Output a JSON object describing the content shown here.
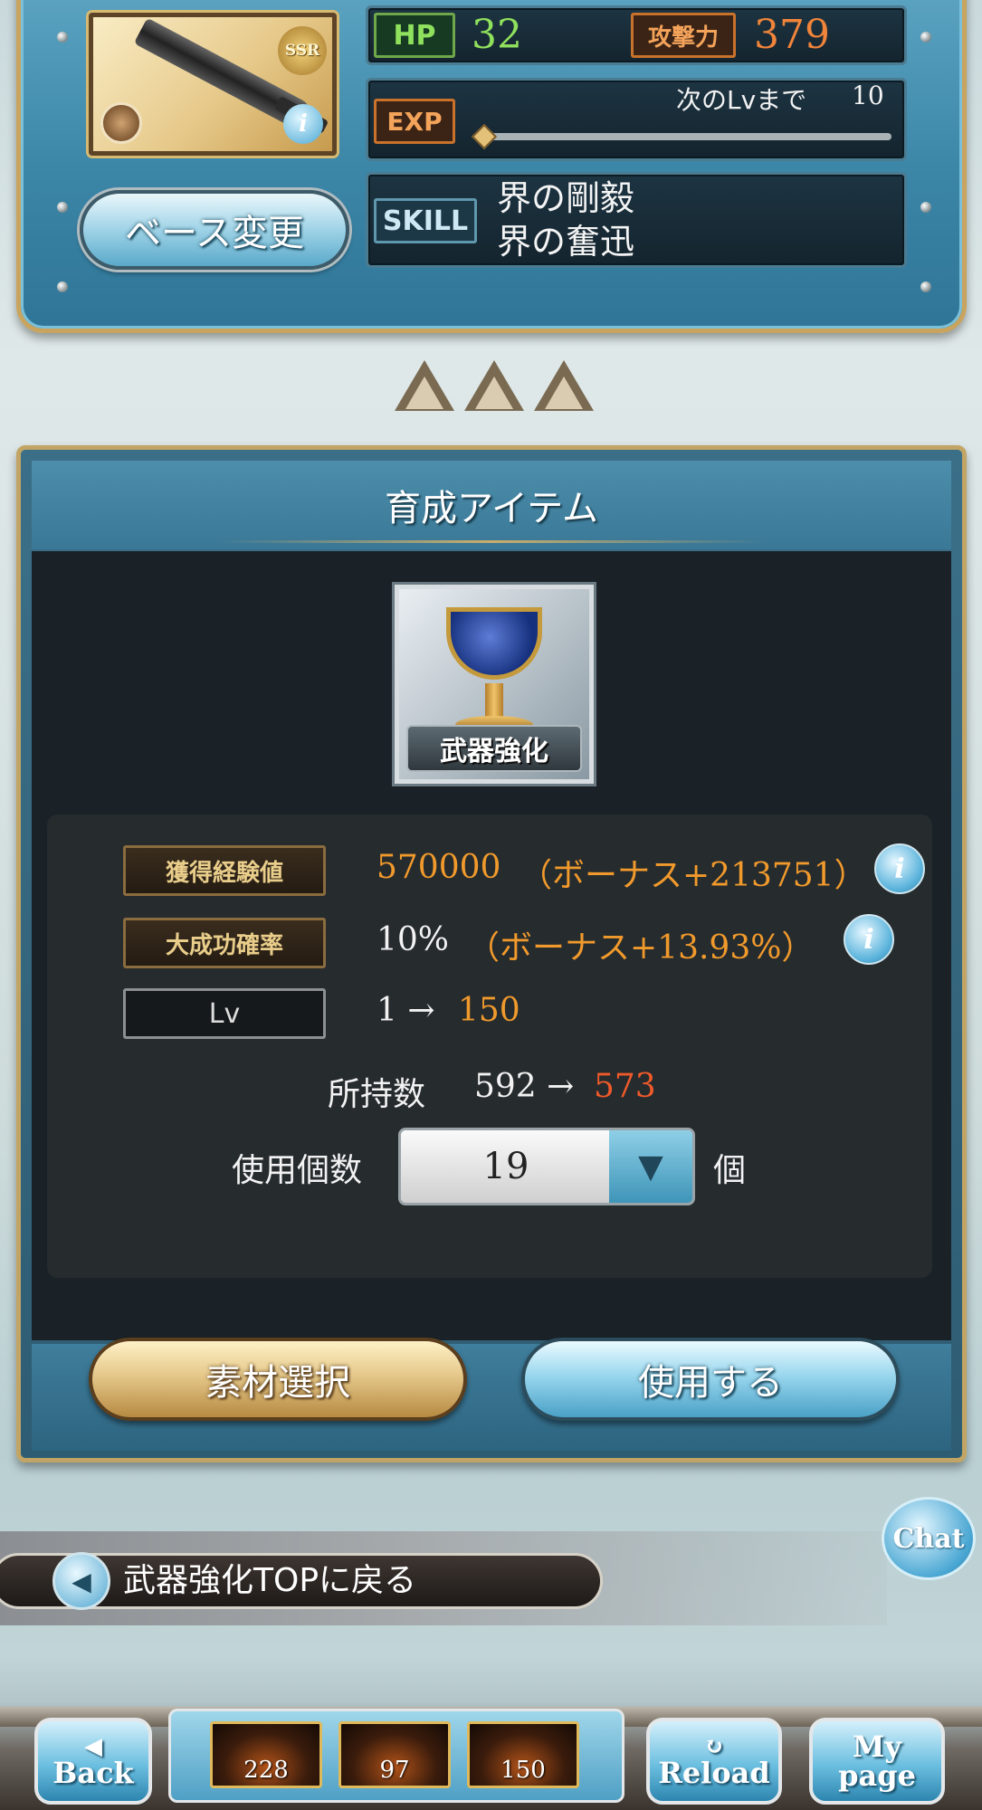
{
  "weapon": {
    "rarity_badge": "SSR",
    "info_icon": "i",
    "base_change_label": "ベース変更"
  },
  "stats": {
    "hp_label": "HP",
    "hp_value": "32",
    "attack_label": "攻撃力",
    "attack_value": "379",
    "exp_label": "EXP",
    "next_level_label": "次のLvまで",
    "next_level_value": "10",
    "exp_progress": 0,
    "skill_label": "SKILL",
    "skills": [
      "界の剛毅",
      "界の奮迅"
    ]
  },
  "item_panel": {
    "title": "育成アイテム",
    "item_name": "武器強化",
    "rows": {
      "exp_label": "獲得経験値",
      "exp_value": "570000",
      "exp_bonus": "（ボーナス+213751）",
      "great_success_label": "大成功確率",
      "great_success_value": "10%",
      "great_success_bonus": "（ボーナス+13.93%）",
      "lv_label": "Lv",
      "lv_from": "1 →",
      "lv_to": "150",
      "owned_label": "所持数",
      "owned_from": "592 →",
      "owned_to": "573",
      "use_count_label": "使用個数",
      "use_count_value": "19",
      "use_count_unit": "個"
    },
    "select_material_button": "素材選択",
    "use_button": "使用する"
  },
  "back_link": "武器強化TOPに戻る",
  "chat_button": "Chat",
  "footer": {
    "back": "Back",
    "reload": "Reload",
    "mypage_line1": "My",
    "mypage_line2": "page",
    "slots": [
      "228",
      "97",
      "150"
    ]
  },
  "colors": {
    "accent_orange": "#f19a2c",
    "accent_red": "#ef5a2b",
    "hp_green": "#8fe05c",
    "panel_blue": "#3b6f88",
    "gold_border": "#c2a565"
  },
  "icons": [
    "ssr-badge",
    "element-icon",
    "info-icon",
    "exp-diamond-icon",
    "triangle-ornament-icon",
    "chalice-icon",
    "dropdown-arrow-icon",
    "back-arrow-icon",
    "chat-icon",
    "reload-icon"
  ]
}
